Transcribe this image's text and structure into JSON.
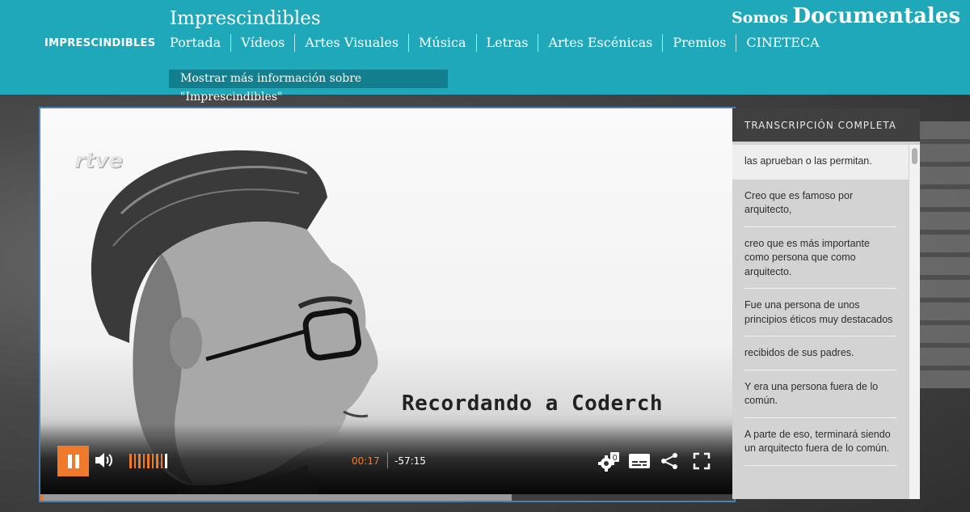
{
  "header": {
    "logo_text": "IMPRESCINDIBLES",
    "site_title": "Imprescindibles",
    "nav": [
      "Portada",
      "Vídeos",
      "Artes Visuales",
      "Música",
      "Letras",
      "Artes Escénicas",
      "Premios",
      "CINETECA"
    ],
    "more_info": "Mostrar más información sobre \"Imprescindibles\"",
    "brand_small": "Somos",
    "brand_big": "Documentales",
    "bg_color": "#1ea8ba"
  },
  "video": {
    "watermark": "rtve",
    "caption": "Recordando a Coderch",
    "time_current": "00:17",
    "time_remaining": "-57:15",
    "played_fraction": 0.005,
    "buffered_fraction": 0.68,
    "volume_level": 8,
    "volume_max": 9,
    "accent_color": "#f07a2c",
    "icons": [
      "pause-icon",
      "volume-icon",
      "settings-icon",
      "subtitles-icon",
      "share-icon",
      "fullscreen-icon"
    ]
  },
  "transcript": {
    "heading": "TRANSCRIPCIÓN COMPLETA",
    "items": [
      "las aprueban o las permitan.",
      "Creo que es famoso por arquitecto,",
      "creo que es más importante como persona que como arquitecto.",
      "Fue una persona de unos principios éticos muy destacados",
      "recibidos de sus padres.",
      "Y era una persona fuera de lo común.",
      "A parte de eso, terminará siendo un arquitecto fuera de lo común."
    ],
    "active_index": 0
  }
}
